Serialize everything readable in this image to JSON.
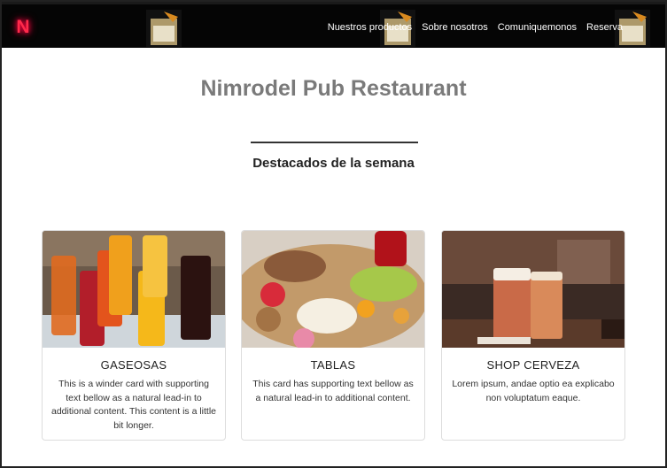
{
  "navbar": {
    "logo_letter": "N",
    "links": [
      "Nuestros productos",
      "Sobre nosotros",
      "Comuniquemonos",
      "Reserva"
    ]
  },
  "hero": {
    "title": "Nimrodel Pub Restaurant",
    "subtitle": "Destacados de la semana"
  },
  "cards": [
    {
      "title": "GASEOSAS",
      "text": "This is a winder card with supporting text bellow as a natural lead-in to additional content. This content is a little bit longer.",
      "image_icon": "soft-drinks-photo"
    },
    {
      "title": "TABLAS",
      "text": "This card has supporting text bellow as a natural lead-in to additional content.",
      "image_icon": "cheese-board-photo"
    },
    {
      "title": "SHOP CERVEZA",
      "text": "Lorem ipsum, andae optio ea explicabo non voluptatum eaque.",
      "image_icon": "beer-glasses-photo"
    }
  ],
  "colors": {
    "navbar_bg": "#050505",
    "logo_neon": "#ff2a4a",
    "title_gray": "#7a7a7a"
  }
}
